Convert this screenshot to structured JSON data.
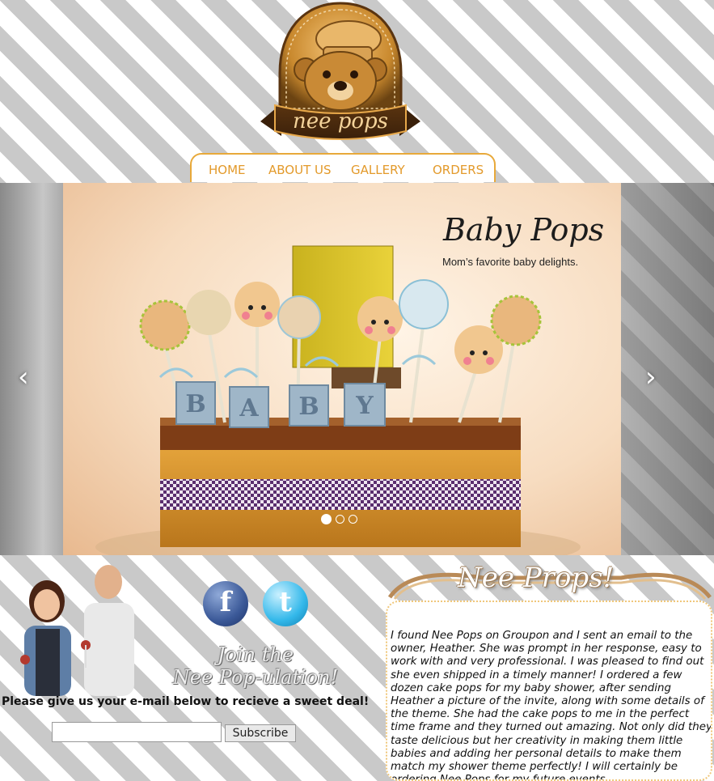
{
  "brand": {
    "logo_text": "nee pops"
  },
  "nav": {
    "items": [
      {
        "label": "HOME"
      },
      {
        "label": "ABOUT US"
      },
      {
        "label": "GALLERY"
      },
      {
        "label": "ORDERS"
      }
    ]
  },
  "carousel": {
    "slide_title": "Baby Pops",
    "slide_subtitle": "Mom’s favorite baby delights.",
    "block_letters": [
      "B",
      "A",
      "B",
      "Y"
    ],
    "prev_icon": "chevron-left-icon",
    "next_icon": "chevron-right-icon",
    "active_slide": 1,
    "slide_count": 3
  },
  "social": {
    "join_line1": "Join the",
    "join_line2": "Nee Pop-ulation!",
    "facebook_glyph": "f",
    "twitter_glyph": "t"
  },
  "newsletter": {
    "prompt": "Please give us your e-mail below to recieve a sweet deal!",
    "input_value": "",
    "subscribe_label": "Subscribe"
  },
  "testimonials": {
    "heading": "Nee Props!",
    "text": "I found Nee Pops on Groupon and I sent an email to the owner, Heather. She was prompt in her response, easy to work with and very professional. I was pleased to find out she even shipped in a timely manner! I ordered a few dozen cake pops for my baby shower, after sending Heather a picture of the invite, along with some details of the theme. She had the cake pops to me in the perfect time frame and they turned out amazing. Not only did they taste delicious but her creativity in making them little babies and adding her personal details to make them match my shower theme perfectly! I will certainly be ordering Nee Pops for my future events."
  },
  "colors": {
    "accent": "#e39a2b",
    "nav_border": "#e8a93a",
    "stripe_light": "#ffffff",
    "stripe_dark": "#c9c9c9"
  }
}
